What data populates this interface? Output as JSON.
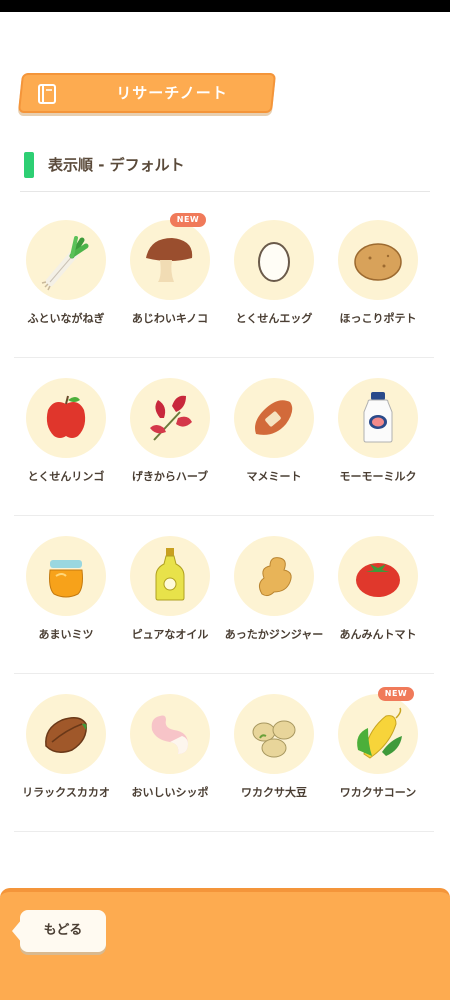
{
  "header": {
    "title": "リサーチノート",
    "book_icon": "book-icon"
  },
  "sort": {
    "label": "表示順 - デフォルト",
    "accent_color": "#2dcf73"
  },
  "colors": {
    "accent": "#fdab50",
    "badge": "#f07a5a",
    "circle_bg": "#fdf3d3"
  },
  "items": [
    {
      "label": "ふといながねぎ",
      "icon": "leek-icon",
      "new": false
    },
    {
      "label": "あじわいキノコ",
      "icon": "mushroom-icon",
      "new": true,
      "badge": "NEW"
    },
    {
      "label": "とくせんエッグ",
      "icon": "egg-icon",
      "new": false
    },
    {
      "label": "ほっこりポテト",
      "icon": "potato-icon",
      "new": false
    },
    {
      "label": "とくせんリンゴ",
      "icon": "apple-icon",
      "new": false
    },
    {
      "label": "げきからハーブ",
      "icon": "herb-icon",
      "new": false
    },
    {
      "label": "マメミート",
      "icon": "meat-icon",
      "new": false
    },
    {
      "label": "モーモーミルク",
      "icon": "milk-icon",
      "new": false
    },
    {
      "label": "あまいミツ",
      "icon": "honey-icon",
      "new": false
    },
    {
      "label": "ピュアなオイル",
      "icon": "oil-icon",
      "new": false
    },
    {
      "label": "あったかジンジャー",
      "icon": "ginger-icon",
      "new": false
    },
    {
      "label": "あんみんトマト",
      "icon": "tomato-icon",
      "new": false
    },
    {
      "label": "リラックスカカオ",
      "icon": "cacao-icon",
      "new": false
    },
    {
      "label": "おいしいシッポ",
      "icon": "tail-icon",
      "new": false
    },
    {
      "label": "ワカクサ大豆",
      "icon": "soybean-icon",
      "new": false
    },
    {
      "label": "ワカクサコーン",
      "icon": "corn-icon",
      "new": true,
      "badge": "NEW"
    }
  ],
  "footer": {
    "back_label": "もどる"
  }
}
